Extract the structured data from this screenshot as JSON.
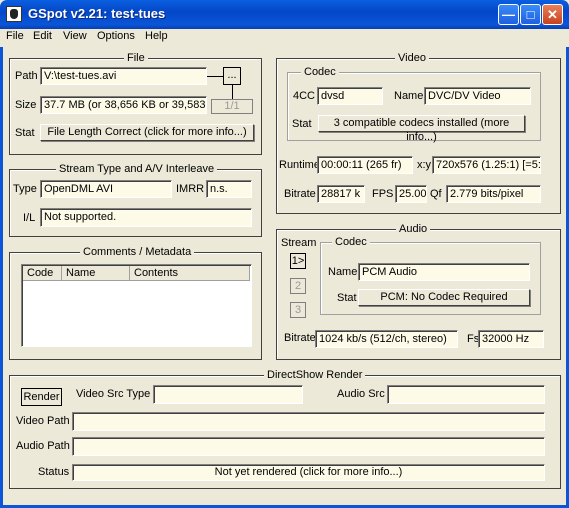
{
  "window": {
    "title": "GSpot v2.21: test-tues"
  },
  "menu": [
    "File",
    "Edit",
    "View",
    "Options",
    "Help"
  ],
  "file": {
    "group_label": "File",
    "path_label": "Path",
    "path_value": "V:\\test-tues.avi",
    "browse_label": "...",
    "size_label": "Size",
    "size_value": "37.7 MB (or 38,656 KB or 39,583,",
    "page_indicator": "1/1",
    "stat_label": "Stat",
    "stat_value": "File Length Correct (click for more info...)"
  },
  "stream": {
    "group_label": "Stream Type and A/V Interleave",
    "type_label": "Type",
    "type_value": "OpenDML AVI",
    "imrr_label": "IMRR",
    "imrr_value": "n.s.",
    "il_label": "I/L",
    "il_value": "Not supported."
  },
  "comments": {
    "group_label": "Comments / Metadata",
    "columns": [
      "Code",
      "Name",
      "Contents"
    ]
  },
  "video": {
    "group_label": "Video",
    "codec_group_label": "Codec",
    "fourcc_label": "4CC",
    "fourcc_value": "dvsd",
    "name_label": "Name",
    "name_value": "DVC/DV Video",
    "stat_label": "Stat",
    "stat_value": "3 compatible codecs installed (more info...)",
    "runtime_label": "Runtime",
    "runtime_value": "00:00:11 (265 fr)",
    "xy_label": "x:y",
    "xy_value": "720x576 (1.25:1) [=5:",
    "bitrate_label": "Bitrate",
    "bitrate_value": "28817 k",
    "fps_label": "FPS",
    "fps_value": "25.00",
    "qf_label": "Qf",
    "qf_value": "2.779 bits/pixel"
  },
  "audio": {
    "group_label": "Audio",
    "stream_label": "Stream",
    "codec_group_label": "Codec",
    "stream_buttons": [
      "1>",
      "2",
      "3"
    ],
    "name_label": "Name",
    "name_value": "PCM Audio",
    "stat_label": "Stat",
    "stat_value": "PCM: No Codec Required",
    "bitrate_label": "Bitrate",
    "bitrate_value": "1024 kb/s (512/ch, stereo)",
    "fs_label": "Fs",
    "fs_value": "32000 Hz"
  },
  "directshow": {
    "group_label": "DirectShow Render",
    "render_label": "Render",
    "video_src_type_label": "Video Src Type",
    "video_src_type_value": "",
    "audio_src_label": "Audio Src",
    "audio_src_value": "",
    "video_path_label": "Video Path",
    "video_path_value": "",
    "audio_path_label": "Audio Path",
    "audio_path_value": "",
    "status_label": "Status",
    "status_value": "Not yet rendered (click for more info...)"
  },
  "colors": {
    "title_bar": "#0a55d8",
    "field_bg": "#fdfbe8",
    "dialog_bg": "#ece9d8"
  }
}
